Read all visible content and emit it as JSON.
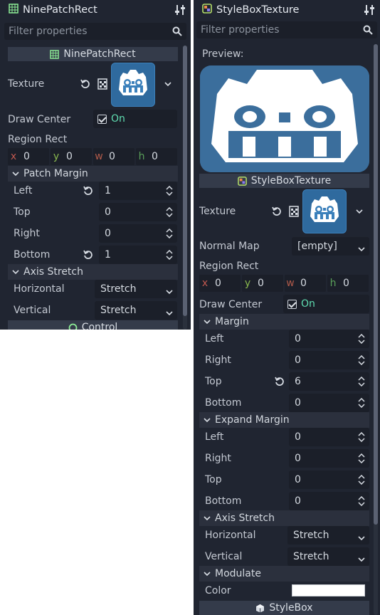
{
  "left_panel": {
    "header_title": "NinePatchRect",
    "filter_placeholder": "Filter properties",
    "section_title": "NinePatchRect",
    "texture_label": "Texture",
    "draw_center_label": "Draw Center",
    "draw_center_value": "On",
    "region_rect_label": "Region Rect",
    "region_rect": {
      "x": "0",
      "y": "0",
      "w": "0",
      "h": "0"
    },
    "patch_margin_title": "Patch Margin",
    "patch_margin": [
      {
        "label": "Left",
        "value": "1",
        "reverted": true
      },
      {
        "label": "Top",
        "value": "0",
        "reverted": false
      },
      {
        "label": "Right",
        "value": "0",
        "reverted": false
      },
      {
        "label": "Bottom",
        "value": "1",
        "reverted": true
      }
    ],
    "axis_stretch_title": "Axis Stretch",
    "axis_stretch": [
      {
        "label": "Horizontal",
        "value": "Stretch"
      },
      {
        "label": "Vertical",
        "value": "Stretch"
      }
    ],
    "footer_section": "Control"
  },
  "right_panel": {
    "header_title": "StyleBoxTexture",
    "filter_placeholder": "Filter properties",
    "preview_label": "Preview:",
    "section_title": "StyleBoxTexture",
    "texture_label": "Texture",
    "normal_map_label": "Normal Map",
    "normal_map_value": "[empty]",
    "region_rect_label": "Region Rect",
    "region_rect": {
      "x": "0",
      "y": "0",
      "w": "0",
      "h": "0"
    },
    "draw_center_label": "Draw Center",
    "draw_center_value": "On",
    "margin_title": "Margin",
    "margin": [
      {
        "label": "Left",
        "value": "0",
        "reverted": false
      },
      {
        "label": "Right",
        "value": "0",
        "reverted": false
      },
      {
        "label": "Top",
        "value": "6",
        "reverted": true
      },
      {
        "label": "Bottom",
        "value": "0",
        "reverted": false
      }
    ],
    "expand_margin_title": "Expand Margin",
    "expand_margin": [
      {
        "label": "Left",
        "value": "0"
      },
      {
        "label": "Right",
        "value": "0"
      },
      {
        "label": "Top",
        "value": "0"
      },
      {
        "label": "Bottom",
        "value": "0"
      }
    ],
    "axis_stretch_title": "Axis Stretch",
    "axis_stretch": [
      {
        "label": "Horizontal",
        "value": "Stretch"
      },
      {
        "label": "Vertical",
        "value": "Stretch"
      }
    ],
    "modulate_title": "Modulate",
    "color_label": "Color",
    "color_value": "#ffffff",
    "footer_section": "StyleBox"
  },
  "colors": {
    "panel_bg": "#202531",
    "field_bg": "#1b1f29",
    "section_bg": "#343b4a",
    "on_text": "#5fdcb0",
    "accent_green": "#8eef97"
  },
  "icons": [
    "ninepatchrect-icon",
    "styleboxtexture-icon",
    "tune-icon",
    "search-icon",
    "revert-icon",
    "checker-texture-icon",
    "godot-logo-icon",
    "chevron-down-icon",
    "spinner-arrows-icon",
    "control-icon",
    "stylebox-cube-icon"
  ]
}
